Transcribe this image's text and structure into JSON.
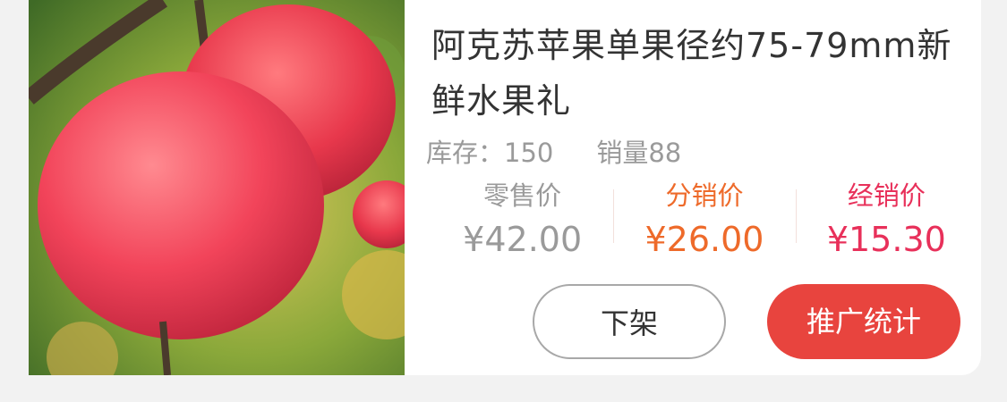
{
  "product": {
    "title": "阿克苏苹果单果径约75-79mm新鲜水果礼",
    "stock_text": "库存：150",
    "sales_text": "销量88",
    "image_icon": "apple-photo"
  },
  "prices": {
    "retail_label": "零售价",
    "retail_value": "¥42.00",
    "distribution_label": "分销价",
    "distribution_value": "¥26.00",
    "dealer_label": "经销价",
    "dealer_value": "¥15.30"
  },
  "actions": {
    "off_shelf_label": "下架",
    "promo_stats_label": "推广统计"
  },
  "colors": {
    "accent_red": "#e8443e",
    "distribution_orange": "#ee6a2a",
    "dealer_pink": "#e8305a",
    "muted_gray": "#9a9a9a"
  }
}
